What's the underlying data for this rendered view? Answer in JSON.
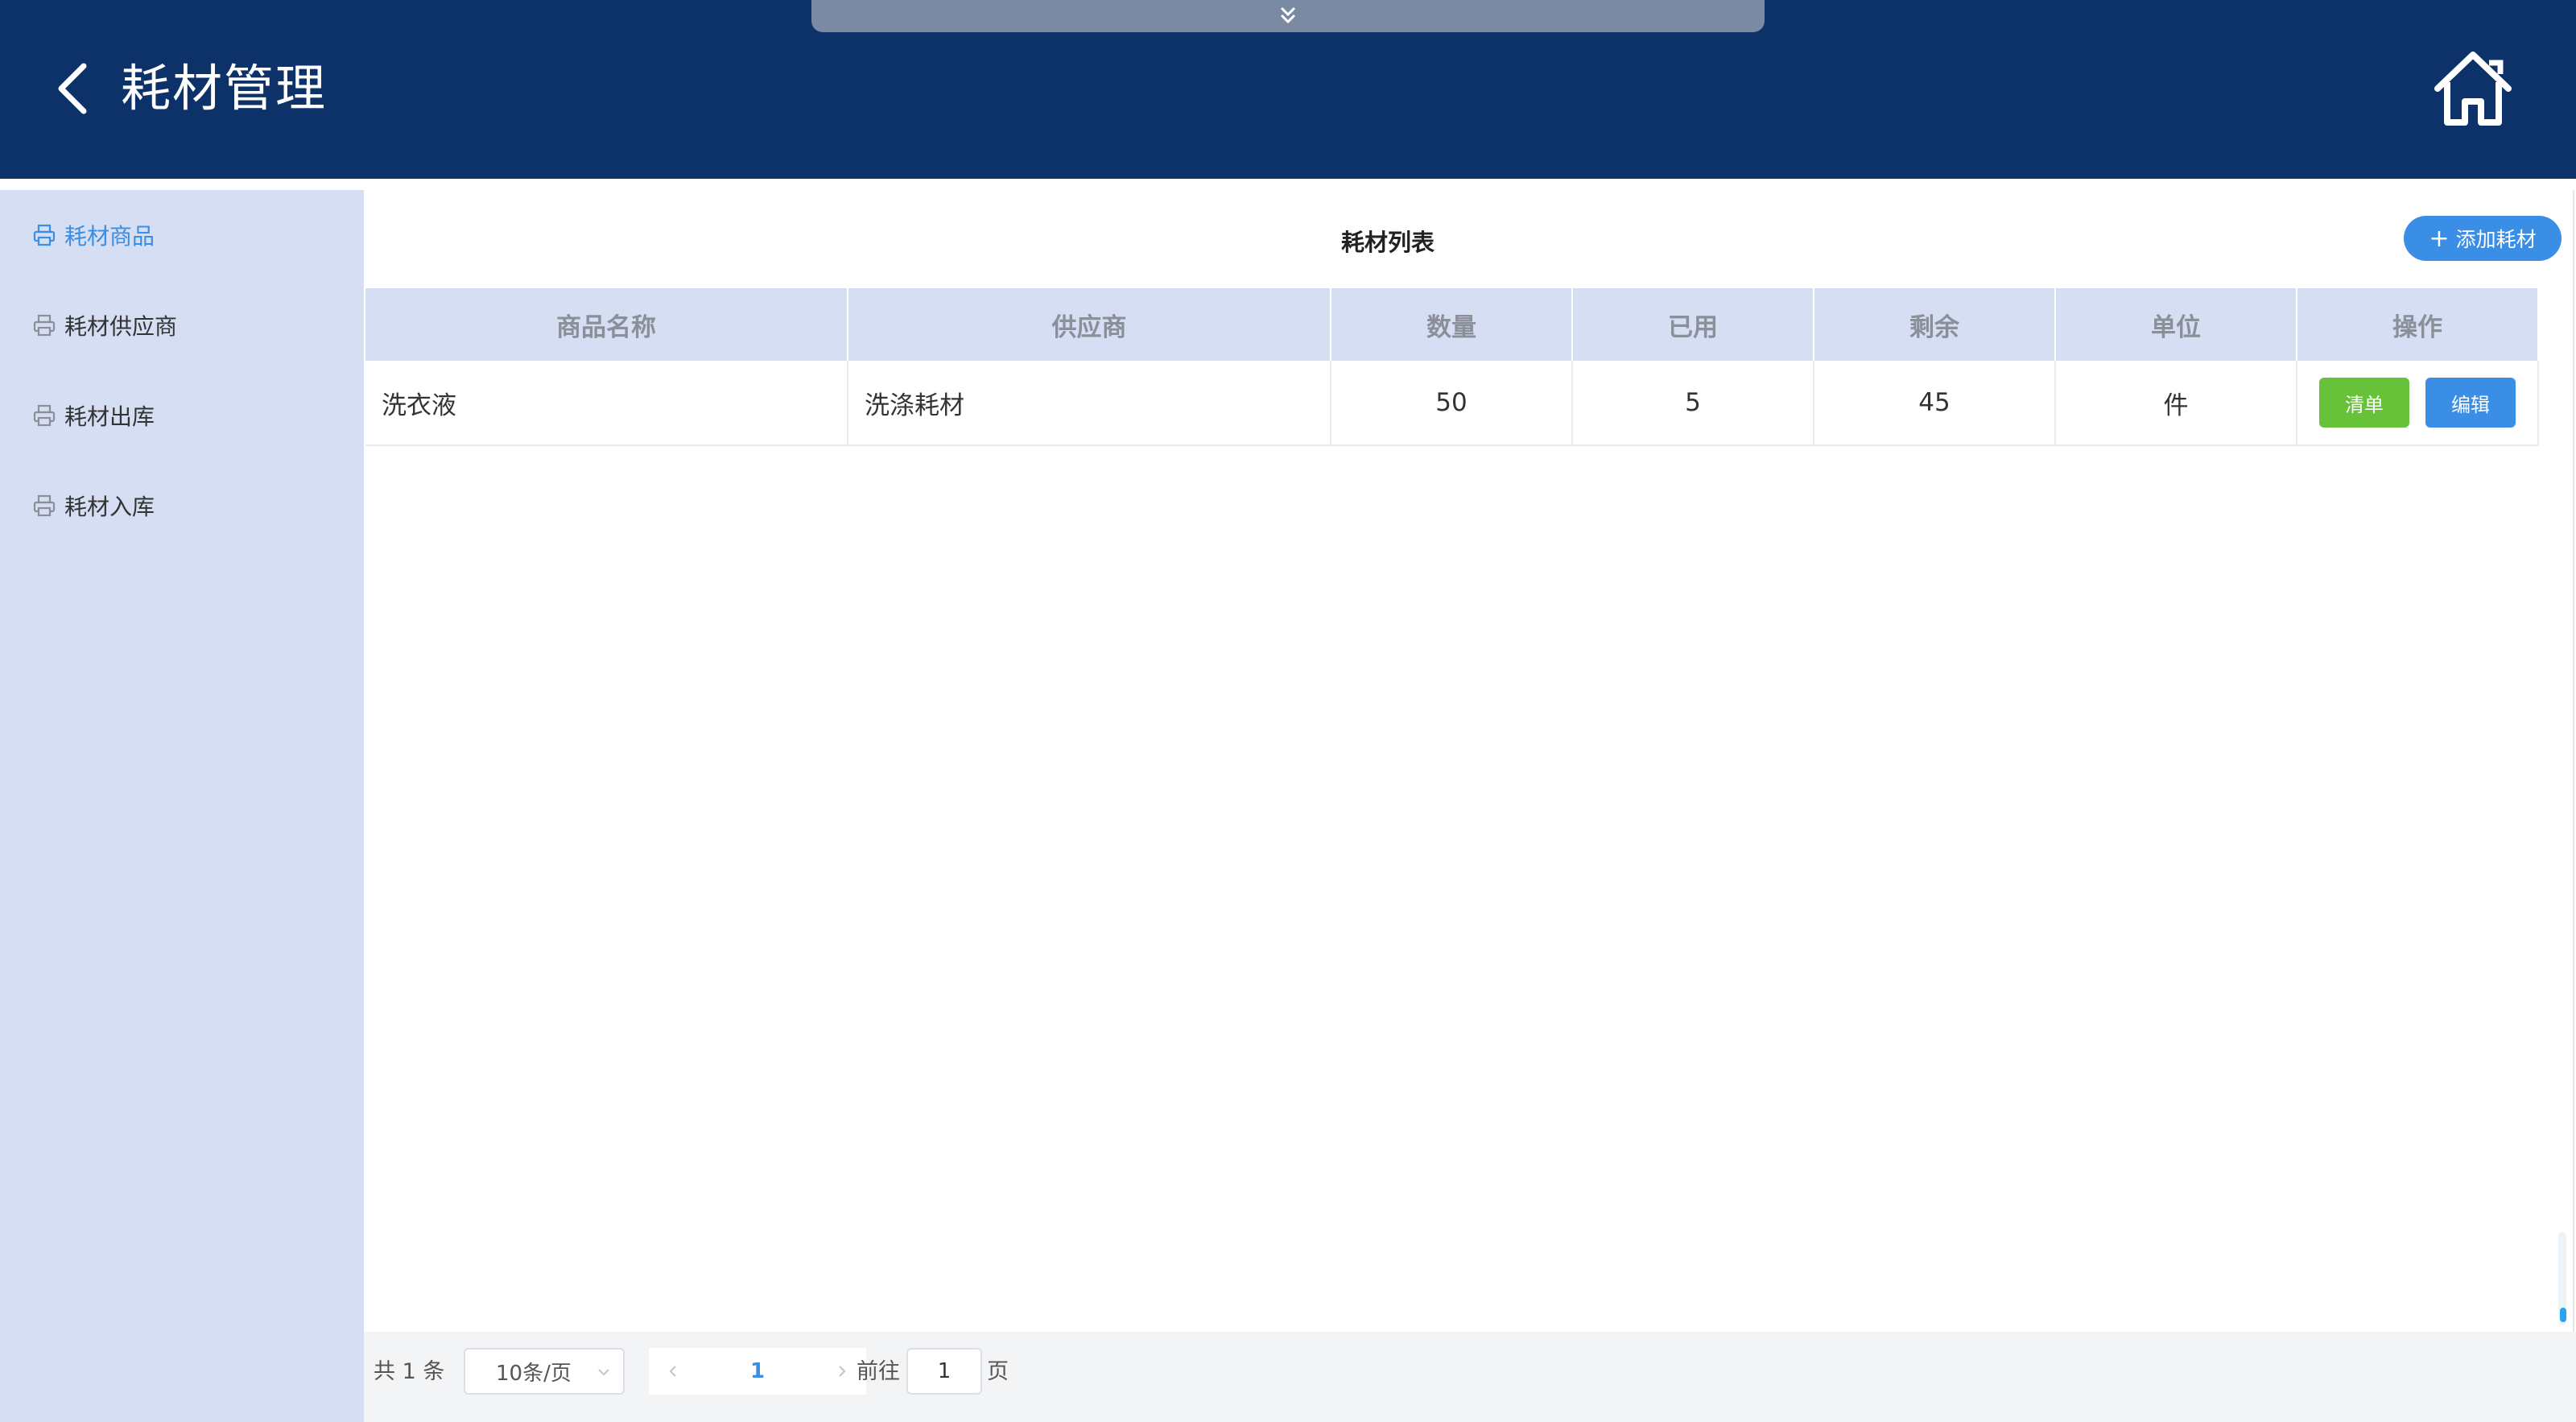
{
  "header": {
    "title": "耗材管理",
    "back_icon": "chevron-left-icon",
    "home_icon": "home-icon",
    "pull_tab_icon": "double-chevron-down-icon",
    "background_color": "#0d3169"
  },
  "sidebar": {
    "items": [
      {
        "label": "耗材商品",
        "icon": "printer-icon",
        "active": true
      },
      {
        "label": "耗材供应商",
        "icon": "printer-icon",
        "active": false
      },
      {
        "label": "耗材出库",
        "icon": "printer-icon",
        "active": false
      },
      {
        "label": "耗材入库",
        "icon": "printer-icon",
        "active": false
      }
    ],
    "active_color": "#3a8ee6"
  },
  "main": {
    "title": "耗材列表",
    "add_button": {
      "label": "添加耗材",
      "icon": "plus-icon"
    },
    "table": {
      "columns": [
        "商品名称",
        "供应商",
        "数量",
        "已用",
        "剩余",
        "单位",
        "操作"
      ],
      "rows": [
        {
          "name": "洗衣液",
          "supplier": "洗涤耗材",
          "quantity": "50",
          "used": "5",
          "remaining": "45",
          "unit": "件",
          "actions": [
            "清单",
            "编辑"
          ]
        }
      ]
    }
  },
  "pagination": {
    "total": "共 1 条",
    "page_size": "10条/页",
    "current_page": "1",
    "goto_label": "前往",
    "goto_value": "1",
    "page_suffix": "页"
  },
  "colors": {
    "primary": "#3a8ee6",
    "success": "#67c23a",
    "sidebar_bg": "#d5def2"
  }
}
